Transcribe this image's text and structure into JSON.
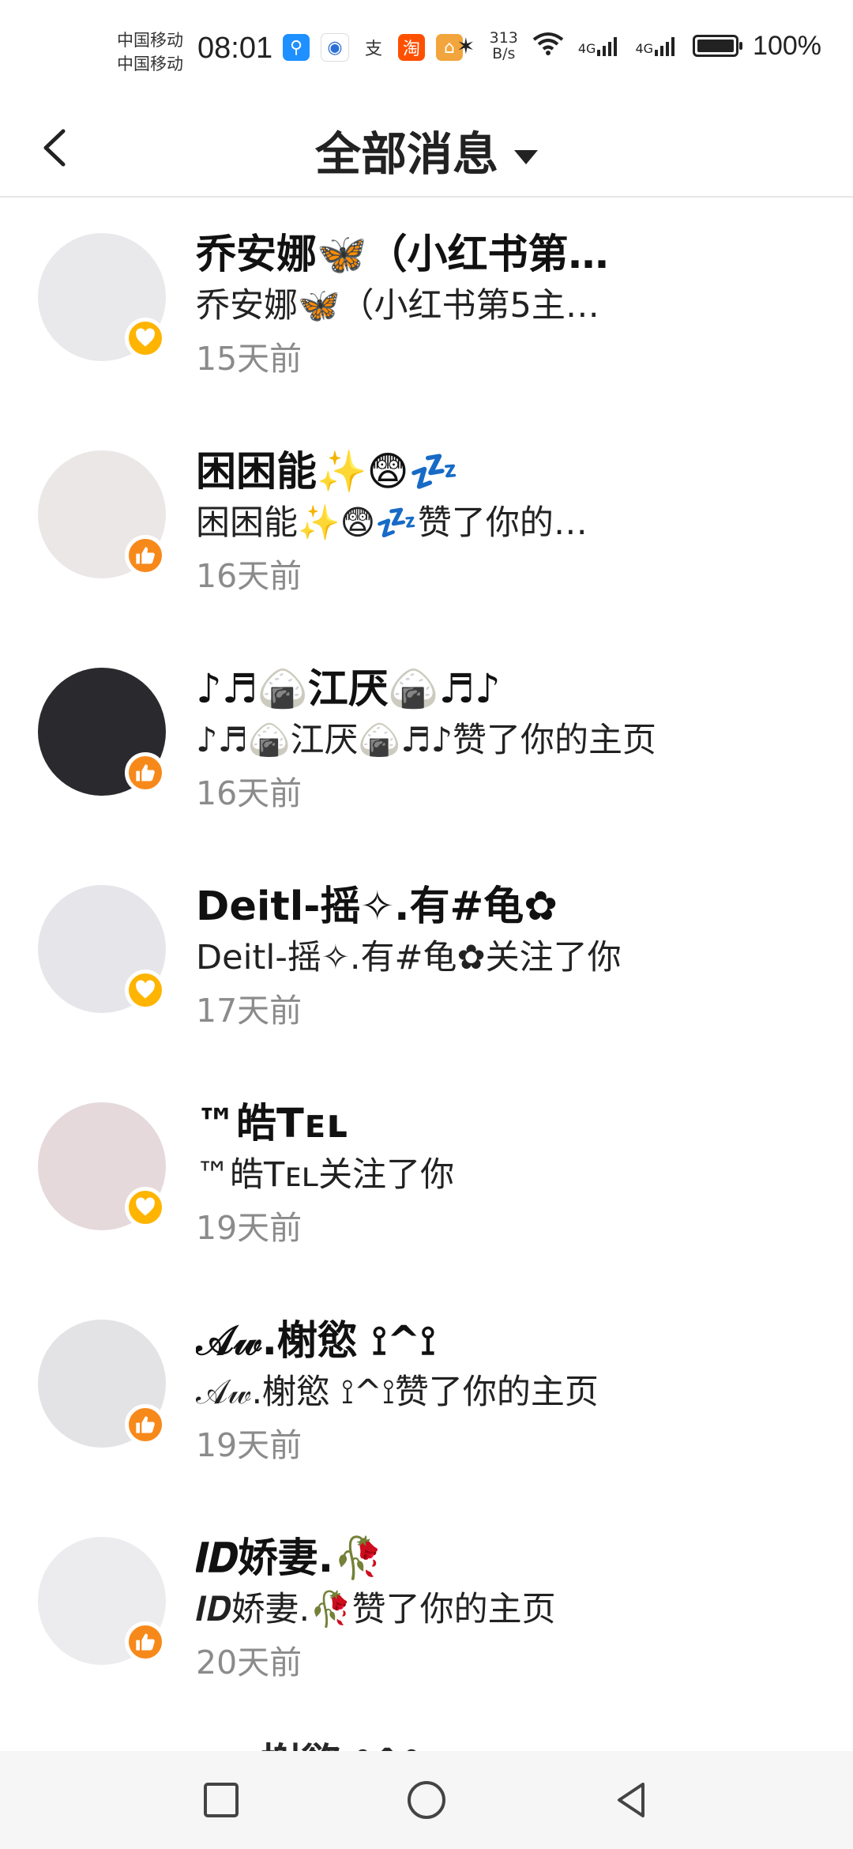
{
  "status_bar": {
    "carrier_1": "中国移动",
    "carrier_2": "中国移动",
    "time": "08:01",
    "net_speed_value": "313",
    "net_speed_unit": "B/s",
    "signal_1": "4G",
    "signal_2": "4G",
    "battery": "100%"
  },
  "header": {
    "title": "全部消息"
  },
  "messages": [
    {
      "name": "乔安娜🦋（小红书第…",
      "desc": "乔安娜🦋（小红书第5主…",
      "time": "15天前",
      "badge": "heart",
      "avatar_color": "#e9e9ec"
    },
    {
      "name": "困困能✨😨💤",
      "desc": "困困能✨😨💤赞了你的…",
      "time": "16天前",
      "badge": "like",
      "avatar_color": "#ebe7e7"
    },
    {
      "name": "♪♬🍙江厌🍙♬♪",
      "desc": "♪♬🍙江厌🍙♬♪赞了你的主页",
      "time": "16天前",
      "badge": "like",
      "avatar_color": "#2a2a2e"
    },
    {
      "name": "Deitl-摇✧.有#龟✿",
      "desc": "Deitl-摇✧.有#龟✿关注了你",
      "time": "17天前",
      "badge": "heart",
      "avatar_color": "#e6e6ea"
    },
    {
      "name": "™皓Tᴇʟ",
      "desc": "™皓Tᴇʟ关注了你",
      "time": "19天前",
      "badge": "heart",
      "avatar_color": "#e5d9dc"
    },
    {
      "name": "𝒜𝓌.榭慾 ⟟^⟟",
      "desc": "𝒜𝓌.榭慾 ⟟^⟟赞了你的主页",
      "time": "19天前",
      "badge": "like",
      "avatar_color": "#e3e3e6"
    },
    {
      "name": "𝑰𝑫娇妻.🥀",
      "desc": "𝑰𝑫娇妻.🥀赞了你的主页",
      "time": "20天前",
      "badge": "like",
      "avatar_color": "#ececef"
    }
  ],
  "partial_next_name": "榭慾 ⟟^⟟"
}
